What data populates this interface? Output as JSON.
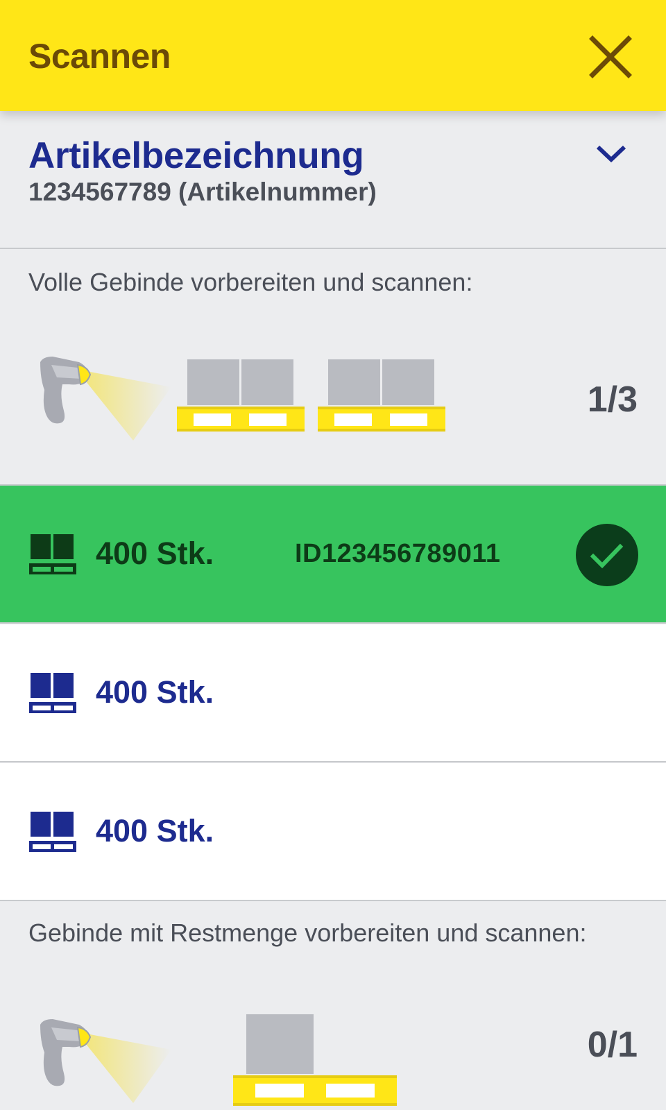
{
  "header": {
    "title": "Scannen",
    "close_icon": "close-icon"
  },
  "article": {
    "name": "Artikelbezeichnung",
    "number": "1234567789 (Artikelnummer)",
    "expand_icon": "chevron-down-icon"
  },
  "full_containers": {
    "label": "Volle Gebinde vorbereiten und scannen:",
    "progress": "1/3",
    "items": [
      {
        "quantity": "400 Stk.",
        "id": "ID123456789011",
        "scanned": true
      },
      {
        "quantity": "400 Stk.",
        "id": "",
        "scanned": false
      },
      {
        "quantity": "400 Stk.",
        "id": "",
        "scanned": false
      }
    ]
  },
  "remainder_containers": {
    "label": "Gebinde mit Restmenge vorbereiten und scannen:",
    "progress": "0/1"
  },
  "colors": {
    "header_bg": "#ffe617",
    "header_text": "#6b4a07",
    "accent_blue": "#1d2b8f",
    "success_green": "#37c45e",
    "success_dark": "#0d3b17",
    "page_bg": "#ecedef"
  }
}
